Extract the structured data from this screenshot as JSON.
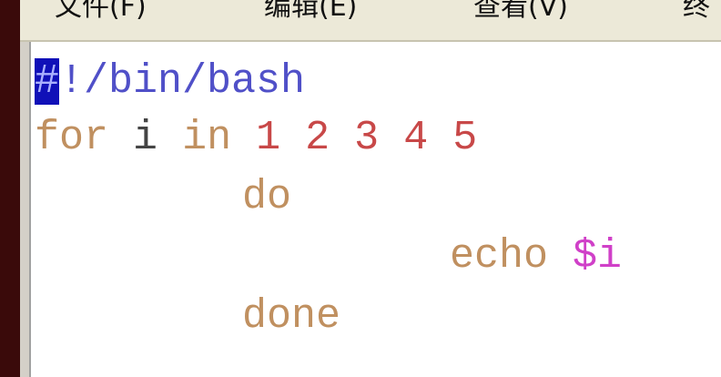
{
  "menubar": {
    "items": [
      {
        "label": "文件(F)"
      },
      {
        "label": "编辑(E)"
      },
      {
        "label": "查看(V)"
      },
      {
        "label": "终"
      }
    ]
  },
  "editor": {
    "line1": {
      "cursor_char": "#",
      "rest": "!/bin/bash"
    },
    "line2": {
      "kw_for": "for",
      "var_i": "i",
      "kw_in": "in",
      "n1": "1",
      "n2": "2",
      "n3": "3",
      "n4": "4",
      "n5": "5"
    },
    "line3": {
      "kw_do": "do"
    },
    "line4": {
      "kw_echo": "echo",
      "arg": "$i"
    },
    "line5": {
      "kw_done": "done"
    }
  },
  "colors": {
    "shebang": "#5050c8",
    "keyword": "#c09060",
    "number": "#c84848",
    "special": "#d040c8",
    "cursor": "#1010b8"
  }
}
